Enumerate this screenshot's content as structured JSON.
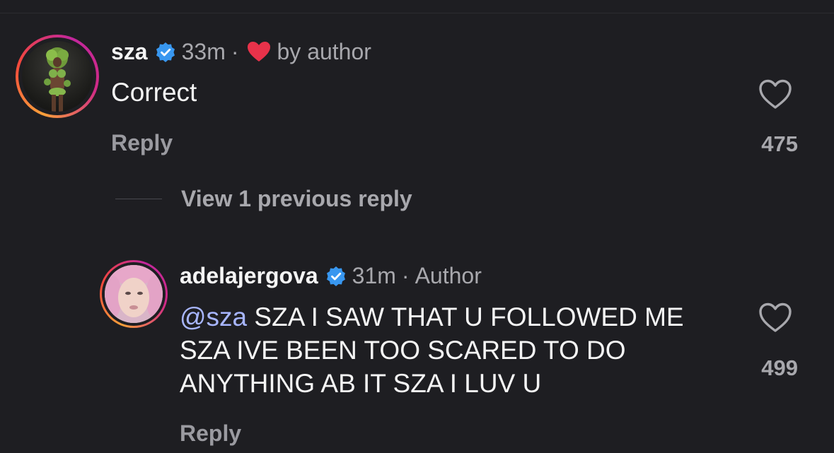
{
  "comments": [
    {
      "username": "sza",
      "time": "33m",
      "separator": "·",
      "author_tag": "by author",
      "text": "Correct",
      "reply_label": "Reply",
      "like_count": "475"
    },
    {
      "username": "adelajergova",
      "time": "31m",
      "separator": "·",
      "author_tag": "Author",
      "mention": "@sza",
      "text": "SZA I SAW THAT U FOLLOWED ME SZA IVE BEEN TOO SCARED TO DO ANYTHING AB IT SZA I LUV U",
      "reply_label": "Reply",
      "like_count": "499"
    }
  ],
  "view_previous": "View 1 previous reply",
  "colors": {
    "background": "#1e1e22",
    "verified": "#3897f0",
    "heart": "#e8324a",
    "mention": "#a8b6ff",
    "muted": "#a8a8ad"
  },
  "icons": [
    "verified-badge-icon",
    "heart-icon",
    "like-outline-icon"
  ]
}
